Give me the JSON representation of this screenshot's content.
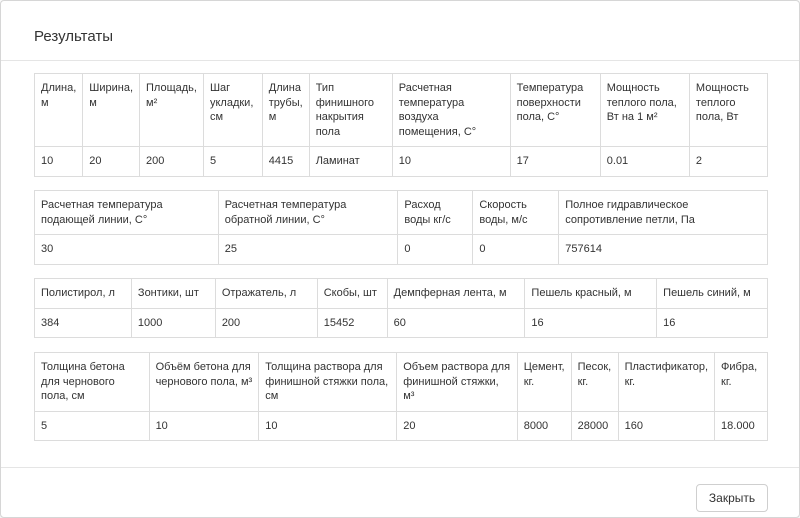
{
  "modal": {
    "title": "Результаты",
    "close_label": "Закрыть"
  },
  "table1": {
    "headers": [
      "Длина, м",
      "Ширина, м",
      "Площадь, м²",
      "Шаг укладки, см",
      "Длина трубы, м",
      "Тип финишного накрытия пола",
      "Расчетная температура воздуха помещения, С°",
      "Температура поверхности пола, С°",
      "Мощность теплого пола, Вт на 1 м²",
      "Мощность теплого пола, Вт"
    ],
    "values": [
      "10",
      "20",
      "200",
      "5",
      "4415",
      "Ламинат",
      "10",
      "17",
      "0.01",
      "2"
    ]
  },
  "table2": {
    "headers": [
      "Расчетная температура подающей линии, С°",
      "Расчетная температура обратной линии, С°",
      "Расход воды кг/с",
      "Скорость воды, м/с",
      "Полное гидравлическое сопротивление петли, Па"
    ],
    "values": [
      "30",
      "25",
      "0",
      "0",
      "757614"
    ]
  },
  "table3": {
    "headers": [
      "Полистирол, л",
      "Зонтики, шт",
      "Отражатель, л",
      "Скобы, шт",
      "Демпферная лента, м",
      "Пешель красный, м",
      "Пешель синий, м"
    ],
    "values": [
      "384",
      "1000",
      "200",
      "15452",
      "60",
      "16",
      "16"
    ]
  },
  "table4": {
    "headers": [
      "Толщина бетона для чернового пола, см",
      "Объём бетона для чернового пола, м³",
      "Толщина раствора для финишной стяжки пола, см",
      "Объем раствора для финишной стяжки, м³",
      "Цемент, кг.",
      "Песок, кг.",
      "Пластификатор, кг.",
      "Фибра, кг."
    ],
    "values": [
      "5",
      "10",
      "10",
      "20",
      "8000",
      "28000",
      "160",
      "18.000"
    ]
  }
}
